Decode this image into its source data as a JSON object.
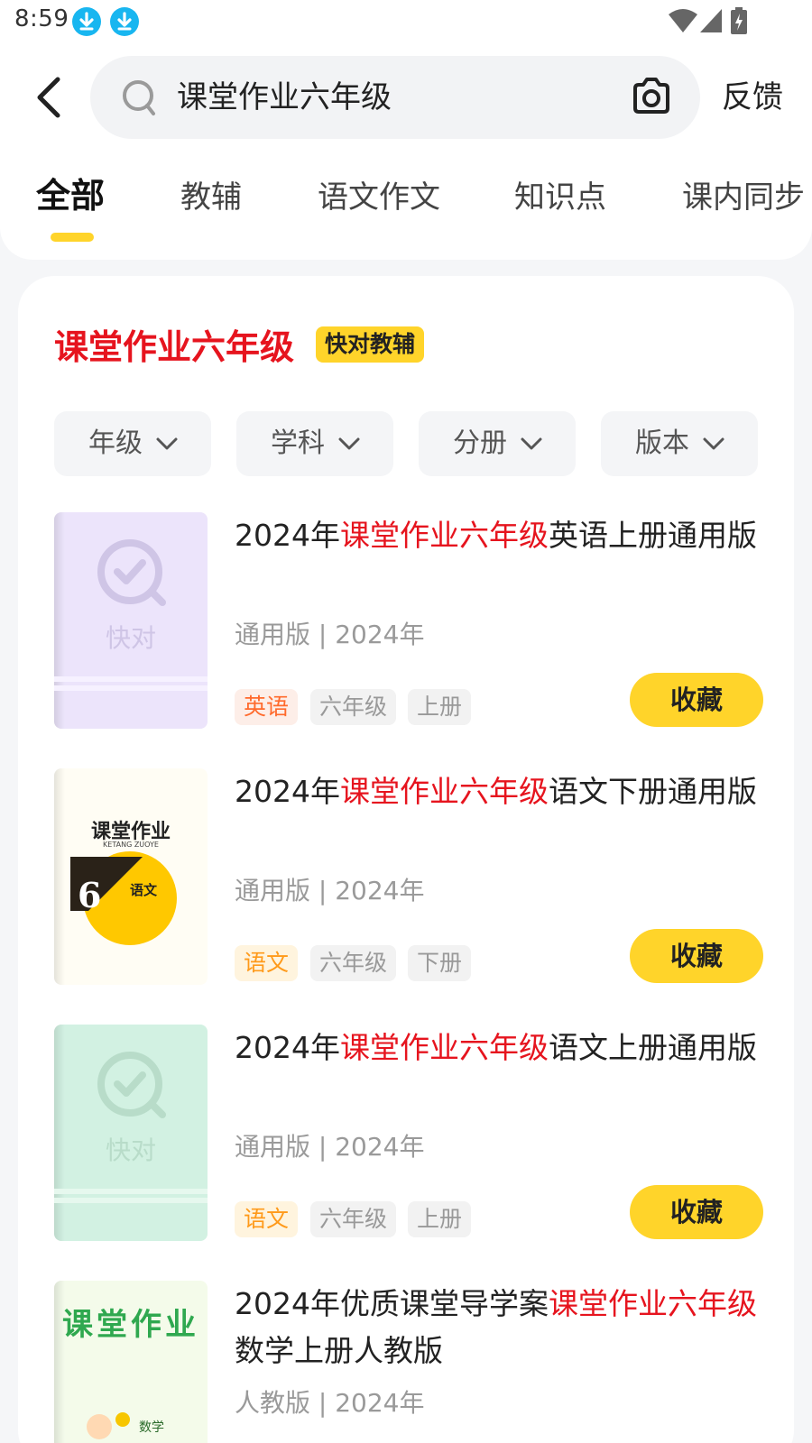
{
  "status_bar": {
    "time": "8:59",
    "icons": [
      "download-icon",
      "download-icon",
      "wifi-icon",
      "signal-icon",
      "battery-charging-icon"
    ]
  },
  "header": {
    "back_icon": "back-arrow-icon",
    "search": {
      "query": "课堂作业六年级",
      "search_icon": "search-icon",
      "camera_icon": "camera-icon"
    },
    "feedback_label": "反馈"
  },
  "tabs": [
    {
      "label": "全部",
      "active": true
    },
    {
      "label": "教辅",
      "active": false
    },
    {
      "label": "语文作文",
      "active": false
    },
    {
      "label": "知识点",
      "active": false
    },
    {
      "label": "课内同步",
      "active": false
    }
  ],
  "result_card": {
    "title": "课堂作业六年级",
    "badge": "快对教辅",
    "filters": [
      {
        "label": "年级"
      },
      {
        "label": "学科"
      },
      {
        "label": "分册"
      },
      {
        "label": "版本"
      }
    ],
    "books": [
      {
        "title_prefix": "2024年",
        "title_highlight": "课堂作业六年级",
        "title_suffix": "英语上册通用版",
        "meta": "通用版 | 2024年",
        "cover_type": "placeholder",
        "cover_text": "快对",
        "cover_color": "#ece4fb",
        "tags": [
          "英语",
          "六年级",
          "上册"
        ],
        "collect_label": "收藏"
      },
      {
        "title_prefix": "2024年",
        "title_highlight": "课堂作业六年级",
        "title_suffix": "语文下册通用版",
        "meta": "通用版 | 2024年",
        "cover_type": "image",
        "cover_title": "课堂作业",
        "cover_subtitle": "KETANG ZUOYE",
        "cover_grade": "6",
        "cover_subject": "语文",
        "tags": [
          "语文",
          "六年级",
          "下册"
        ],
        "collect_label": "收藏"
      },
      {
        "title_prefix": "2024年",
        "title_highlight": "课堂作业六年级",
        "title_suffix": "语文上册通用版",
        "meta": "通用版 | 2024年",
        "cover_type": "placeholder",
        "cover_text": "快对",
        "cover_color": "#d2f1e2",
        "tags": [
          "语文",
          "六年级",
          "上册"
        ],
        "collect_label": "收藏"
      },
      {
        "title_prefix": "2024年优质课堂导学案",
        "title_highlight": "课堂作业六年级",
        "title_suffix": "数学上册人教版",
        "meta": "人教版 | 2024年",
        "cover_type": "image",
        "cover_title": "课堂作业",
        "cover_subject": "数学"
      }
    ]
  },
  "colors": {
    "accent_yellow": "#ffd42a",
    "highlight_red": "#e6141e",
    "tag_orange": "#ff6a2c",
    "tag_amber": "#ff9a1a"
  }
}
